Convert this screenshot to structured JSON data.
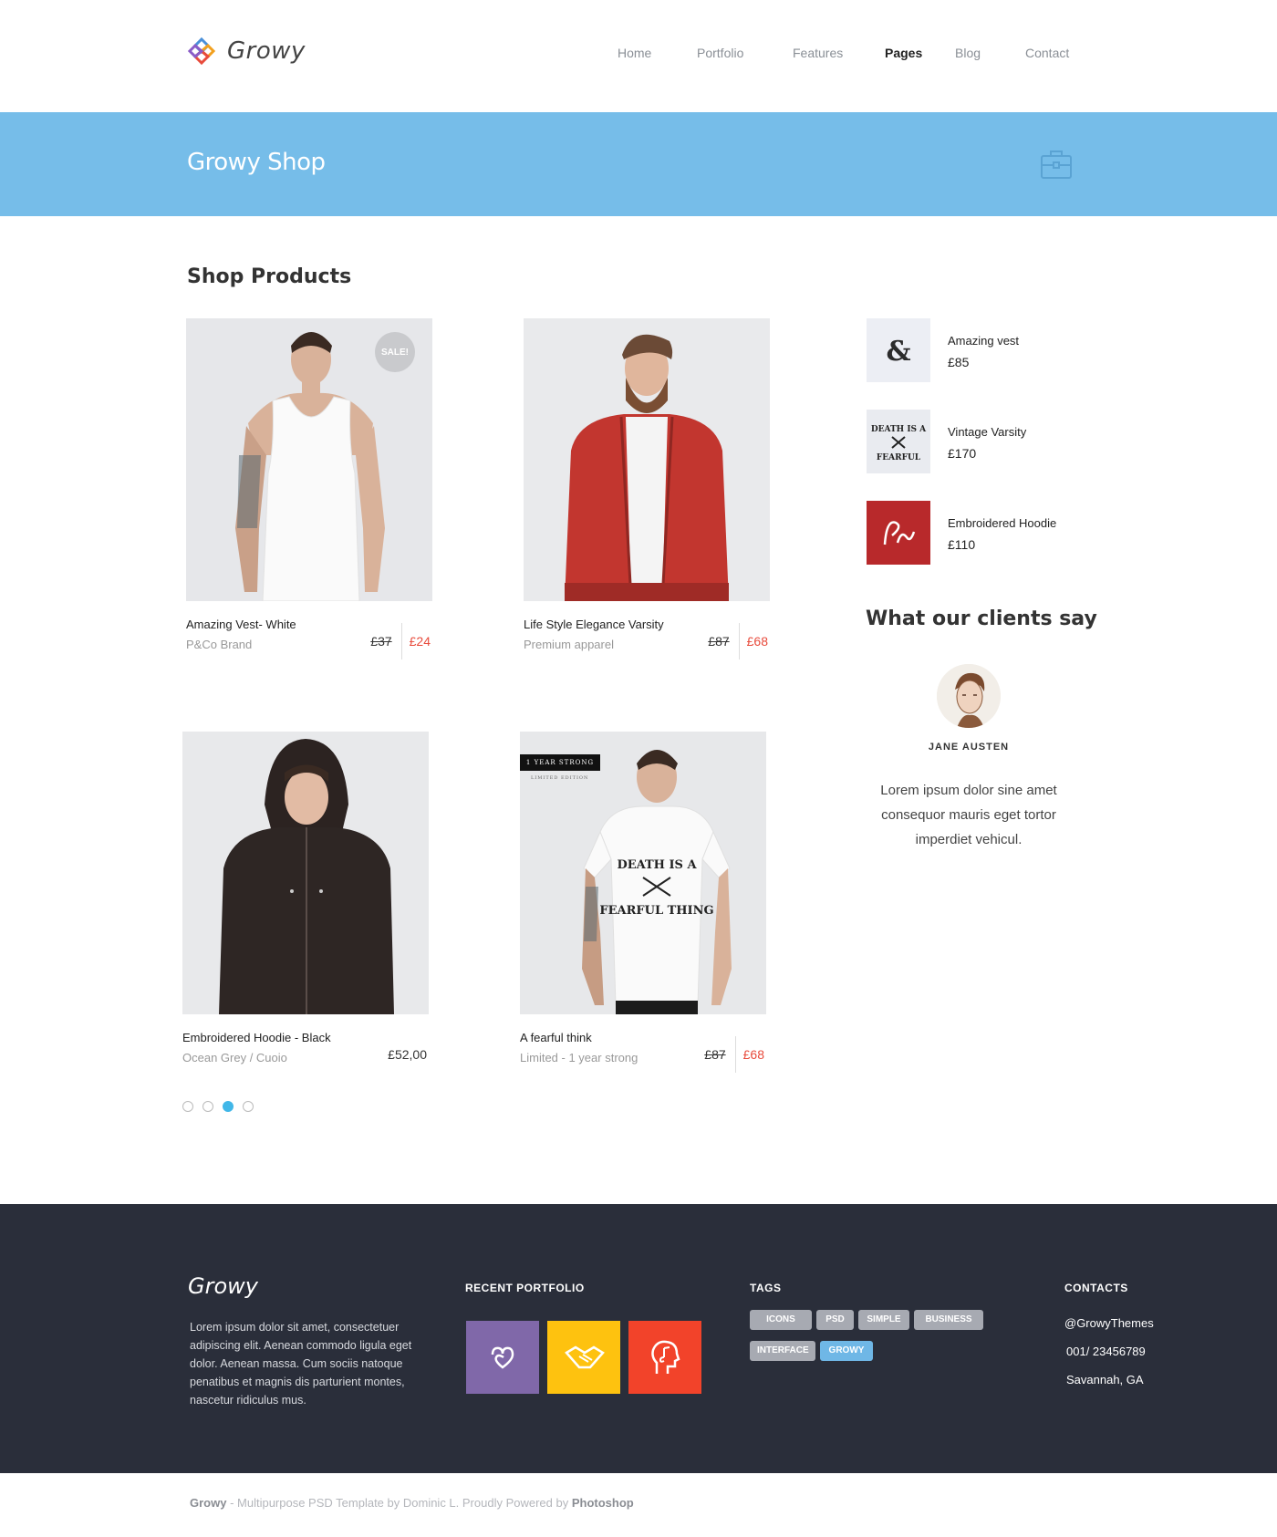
{
  "brand": {
    "name": "Growy"
  },
  "nav": {
    "items": [
      {
        "label": "Home"
      },
      {
        "label": "Portfolio"
      },
      {
        "label": "Features"
      },
      {
        "label": "Pages"
      },
      {
        "label": "Blog"
      },
      {
        "label": "Contact"
      }
    ],
    "active": "Pages"
  },
  "banner": {
    "title": "Growy Shop",
    "icon": "briefcase-icon",
    "color": "#76bde9"
  },
  "shop": {
    "title": "Shop Products",
    "products": [
      {
        "name": "Amazing Vest- White",
        "subtitle": "P&Co Brand",
        "old_price": "£37",
        "price": "£24",
        "badge": "SALE!"
      },
      {
        "name": "Life Style Elegance Varsity",
        "subtitle": "Premium apparel",
        "old_price": "£87",
        "price": "£68"
      },
      {
        "name": "Embroidered Hoodie - Black",
        "subtitle": "Ocean Grey / Cuoio",
        "price": "£52,00"
      },
      {
        "name": "A fearful think",
        "subtitle": "Limited - 1 year strong",
        "old_price": "£87",
        "price": "£68",
        "tag": "1 YEAR STRONG",
        "tag_sub": "LIMITED EDITION"
      }
    ],
    "pagination": {
      "pages": 4,
      "current": 3
    }
  },
  "sidebar": {
    "items": [
      {
        "name": "Amazing vest",
        "price": "£85"
      },
      {
        "name": "Vintage Varsity",
        "price": "£170"
      },
      {
        "name": "Embroidered Hoodie",
        "price": "£110"
      }
    ],
    "clients_title": "What our clients say",
    "testimonial": {
      "name": "JANE AUSTEN",
      "quote": "Lorem ipsum dolor sine amet consequor mauris eget tortor imperdiet vehicul."
    }
  },
  "footer": {
    "logo": "Growy",
    "about": "Lorem ipsum dolor sit amet, consectetuer adipiscing elit. Aenean commodo ligula eget dolor. Aenean massa. Cum sociis natoque penatibus et magnis dis parturient montes, nascetur ridiculus mus.",
    "recent_portfolio": {
      "heading": "RECENT PORTFOLIO",
      "tiles": [
        {
          "color": "#8068a9",
          "icon": "heart-loop-icon"
        },
        {
          "color": "#fec20f",
          "icon": "handshake-icon"
        },
        {
          "color": "#f2432a",
          "icon": "head-music-icon"
        }
      ]
    },
    "tags": {
      "heading": "TAGS",
      "items": [
        "ICONS",
        "PSD",
        "SIMPLE",
        "BUSINESS",
        "INTERFACE",
        "GROWY"
      ],
      "active": "GROWY"
    },
    "contacts": {
      "heading": "CONTACTS",
      "twitter": "@GrowyThemes",
      "phone": "001/ 23456789",
      "location": "Savannah, GA"
    }
  },
  "bottom_bar": {
    "brand": "Growy",
    "text": " - Multipurpose PSD Template by Dominic L. Proudly Powered by ",
    "powered": "Photoshop"
  }
}
